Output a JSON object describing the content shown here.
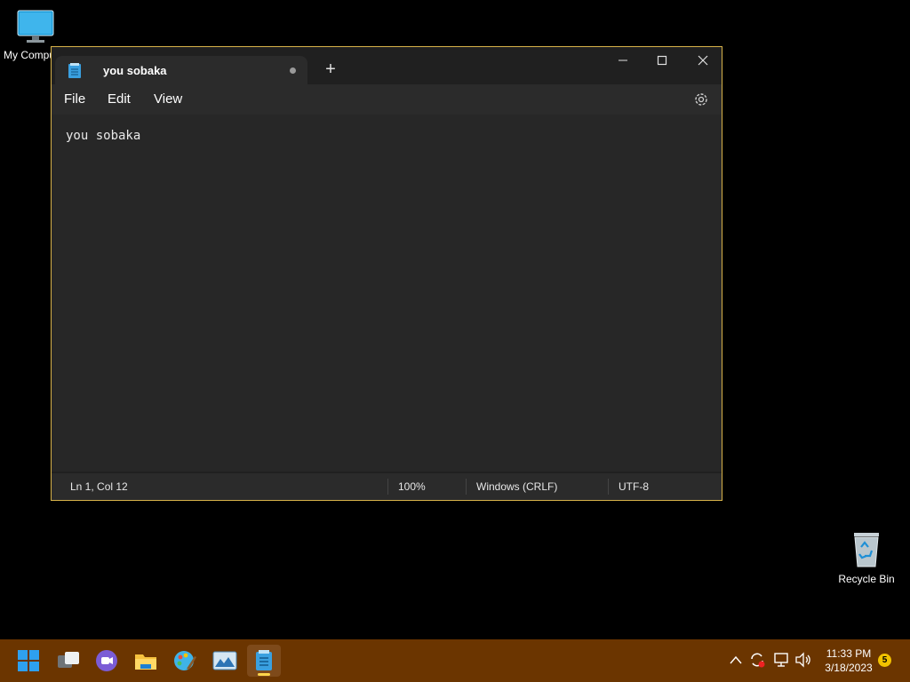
{
  "desktop": {
    "icons": [
      {
        "label": "My Computer"
      },
      {
        "label": "Recycle Bin"
      }
    ]
  },
  "notepad": {
    "tab_title": "you sobaka",
    "unsaved_indicator": true,
    "menu": {
      "file": "File",
      "edit": "Edit",
      "view": "View"
    },
    "content": "you sobaka",
    "status": {
      "position": "Ln 1, Col 12",
      "zoom": "100%",
      "line_endings": "Windows (CRLF)",
      "encoding": "UTF-8"
    }
  },
  "taskbar": {
    "apps": [
      "start-icon",
      "task-view-icon",
      "chat-icon",
      "file-explorer-icon",
      "paint-icon",
      "photos-icon",
      "notepad-icon"
    ],
    "clock": {
      "time": "11:33 PM",
      "date": "3/18/2023"
    },
    "notification_count": "5"
  },
  "colors": {
    "taskbar": "#6b3500",
    "window_border": "#d7b24a",
    "accent": "#ffd54a"
  }
}
